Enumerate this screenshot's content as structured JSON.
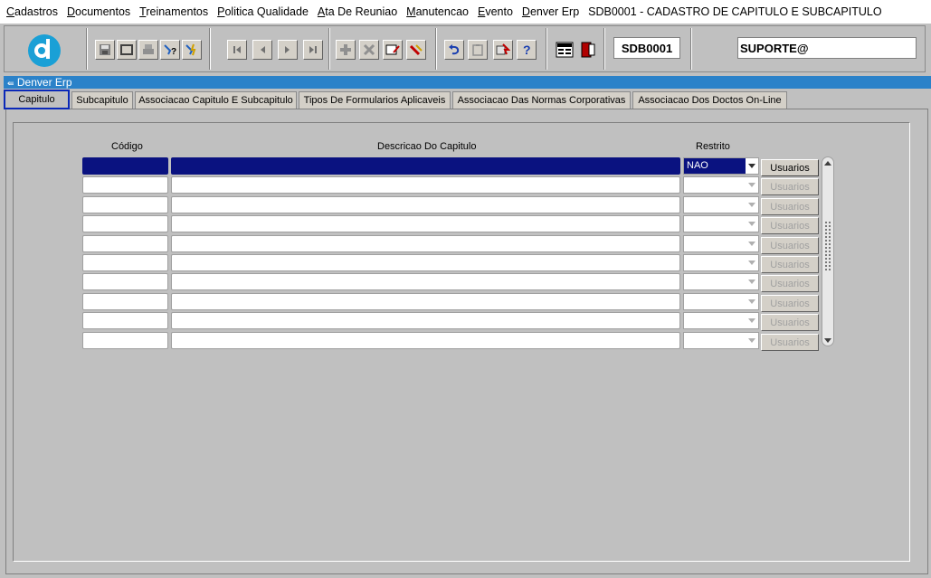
{
  "menu": {
    "items": [
      {
        "first": "C",
        "rest": "adastros"
      },
      {
        "first": "D",
        "rest": "ocumentos"
      },
      {
        "first": "T",
        "rest": "reinamentos"
      },
      {
        "first": "P",
        "rest": "olitica Qualidade"
      },
      {
        "first": "A",
        "rest": "ta De Reuniao"
      },
      {
        "first": "M",
        "rest": "anutencao"
      },
      {
        "first": "E",
        "rest": "vento"
      },
      {
        "first": "D",
        "rest": "enver Erp"
      }
    ],
    "window_title": "SDB0001 - CADASTRO DE CAPITULO E SUBCAPITULO"
  },
  "toolbar": {
    "form_code": "SDB0001",
    "user": "SUPORTE@"
  },
  "window": {
    "title": "Denver Erp"
  },
  "tabs": [
    "Capitulo",
    "Subcapitulo",
    "Associacao Capitulo E Subcapitulo",
    "Tipos De Formularios Aplicaveis",
    "Associacao Das Normas Corporativas",
    "Associacao Dos Doctos On-Line"
  ],
  "grid": {
    "headers": {
      "codigo": "Código",
      "descricao": "Descricao Do Capitulo",
      "restrito": "Restrito"
    },
    "rows": [
      {
        "codigo": "",
        "descricao": "",
        "restrito": "NAO",
        "button": "Usuarios",
        "selected": true
      },
      {
        "codigo": "",
        "descricao": "",
        "restrito": "",
        "button": "Usuarios"
      },
      {
        "codigo": "",
        "descricao": "",
        "restrito": "",
        "button": "Usuarios"
      },
      {
        "codigo": "",
        "descricao": "",
        "restrito": "",
        "button": "Usuarios"
      },
      {
        "codigo": "",
        "descricao": "",
        "restrito": "",
        "button": "Usuarios"
      },
      {
        "codigo": "",
        "descricao": "",
        "restrito": "",
        "button": "Usuarios"
      },
      {
        "codigo": "",
        "descricao": "",
        "restrito": "",
        "button": "Usuarios"
      },
      {
        "codigo": "",
        "descricao": "",
        "restrito": "",
        "button": "Usuarios"
      },
      {
        "codigo": "",
        "descricao": "",
        "restrito": "",
        "button": "Usuarios"
      },
      {
        "codigo": "",
        "descricao": "",
        "restrito": "",
        "button": "Usuarios"
      }
    ]
  },
  "colors": {
    "selection": "#0a1280",
    "window_bar": "#2b82c9",
    "background": "#c0c0c0"
  }
}
